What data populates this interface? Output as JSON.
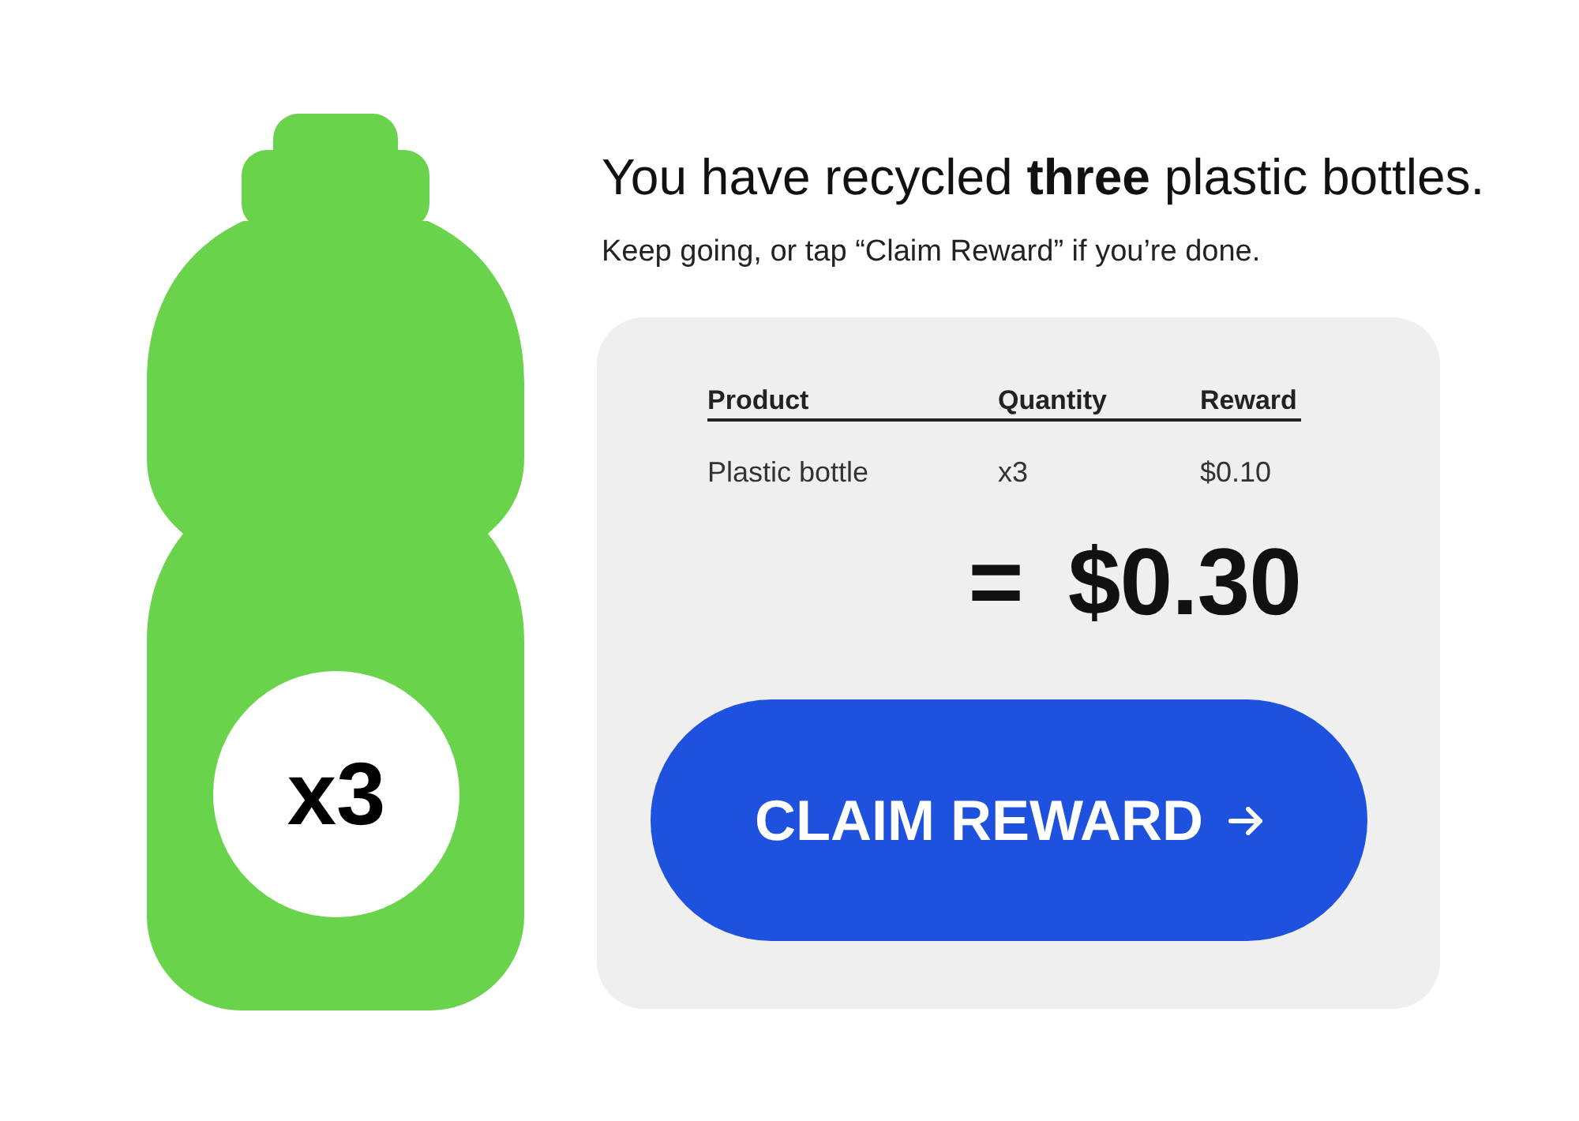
{
  "bottle": {
    "badge": "x3"
  },
  "message": {
    "title": "You have recycled **three** plastic bottles.",
    "subtitle": "Keep going, or tap “Claim Reward” if you’re done."
  },
  "table": {
    "columns": [
      "Product",
      "Quantity",
      "Reward"
    ],
    "rows": [
      [
        "Plastic bottle",
        "x3",
        "$0.10"
      ]
    ]
  },
  "total": {
    "sign": "=",
    "amount": "$0.30"
  },
  "button": {
    "label": "CLAIM REWARD"
  }
}
